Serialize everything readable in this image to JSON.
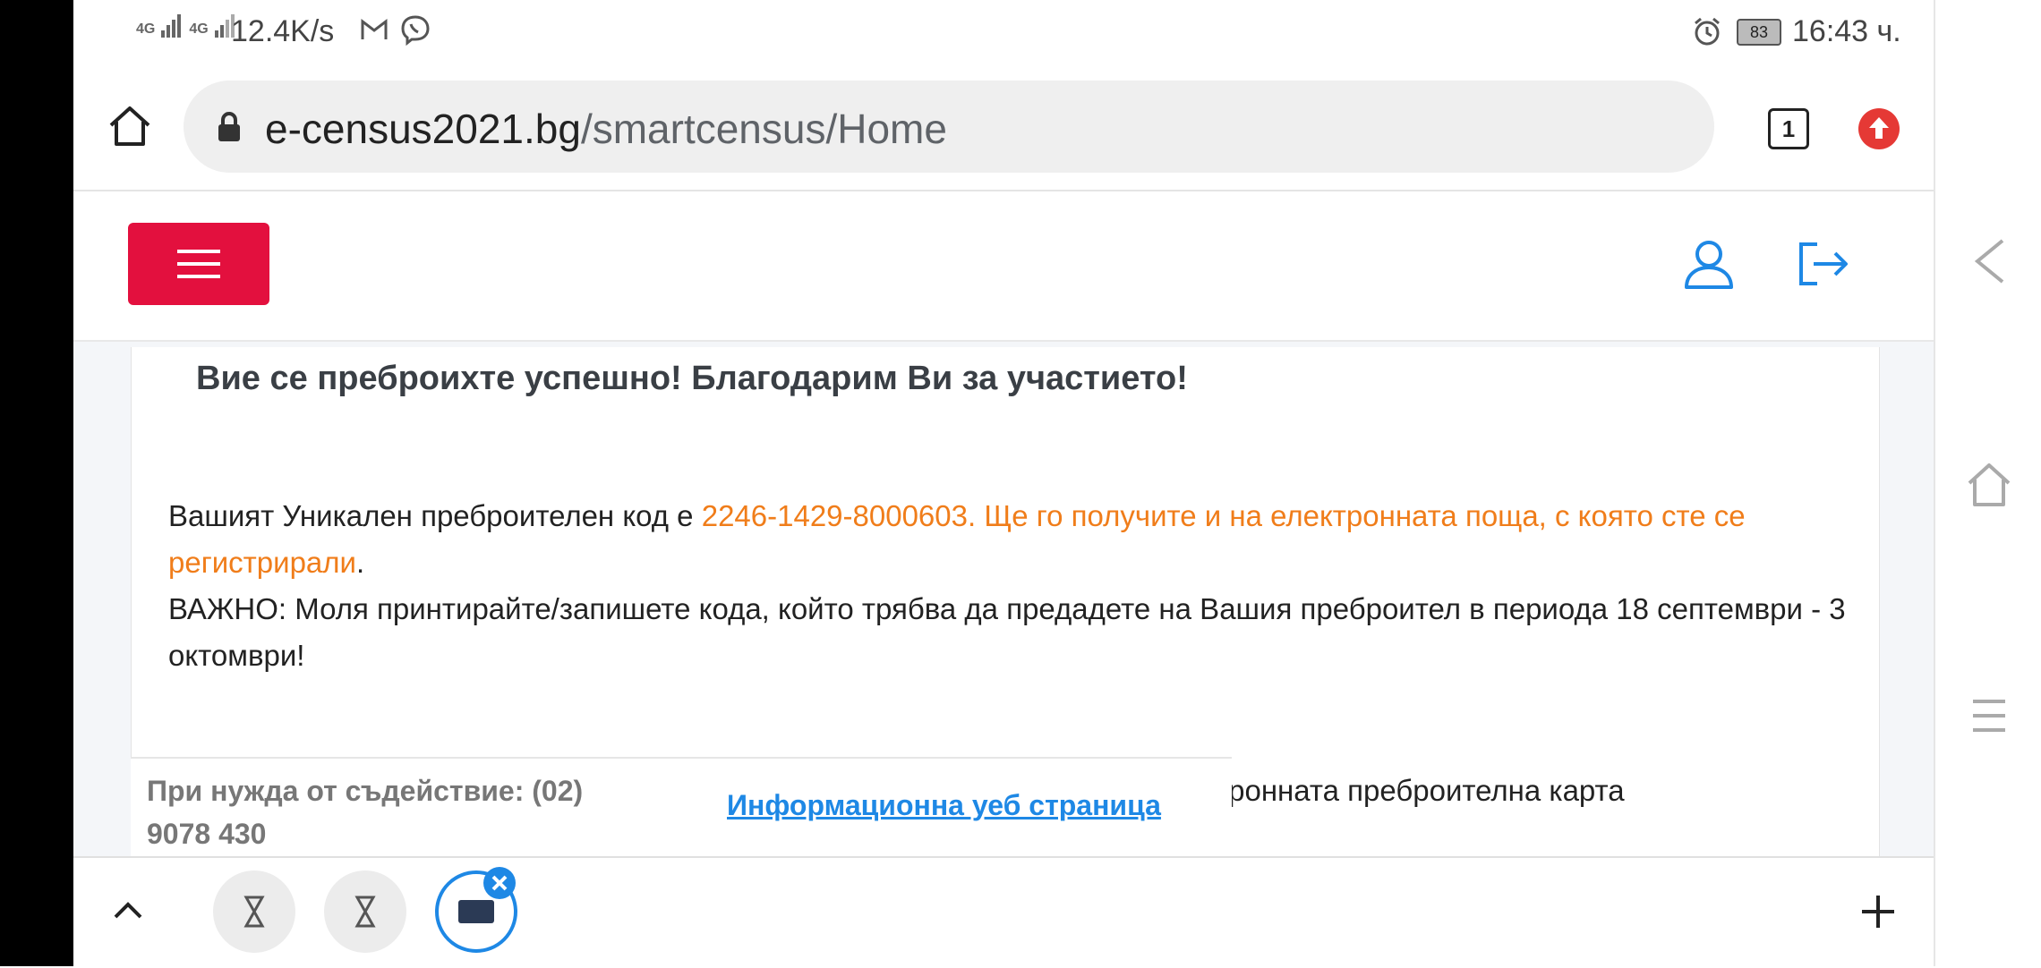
{
  "status_bar": {
    "network_1": "4G",
    "network_2": "4G",
    "speed": "12.4K/s",
    "battery": "83",
    "time": "16:43 ч."
  },
  "browser": {
    "url_domain": "e-census2021.bg",
    "url_path": "/smartcensus/Home",
    "tab_count": "1"
  },
  "content": {
    "heading": "Вие се преброихте успешно! Благодарим Ви за участието!",
    "code_prefix": "Вашият Уникален преброителен код е ",
    "code_highlight": "2246-1429-8000603. Ще го получите и на електронната поща, с която сте се регистрирали",
    "code_suffix": ".",
    "important": "ВАЖНО: Моля принтирайте/запишете кода, който трябва да предадете на Вашия преброител в периода 18 септември - 3 октомври!",
    "partial_line": "тронната преброителна карта"
  },
  "footer": {
    "help_text": "При нужда от съдействие: (02) 9078 430",
    "info_link": "Информационна уеб страница"
  },
  "colors": {
    "accent_red": "#e3103e",
    "link_blue": "#1e88e5",
    "highlight_orange": "#f07d1a"
  },
  "icons": [
    "home-icon",
    "lock-icon",
    "tabs-icon",
    "update-icon",
    "menu-icon",
    "user-icon",
    "logout-icon",
    "back-icon",
    "nav-home-icon",
    "recents-icon",
    "chevron-up-icon",
    "plus-icon",
    "close-icon",
    "alarm-icon",
    "gmail-icon",
    "viber-icon"
  ]
}
